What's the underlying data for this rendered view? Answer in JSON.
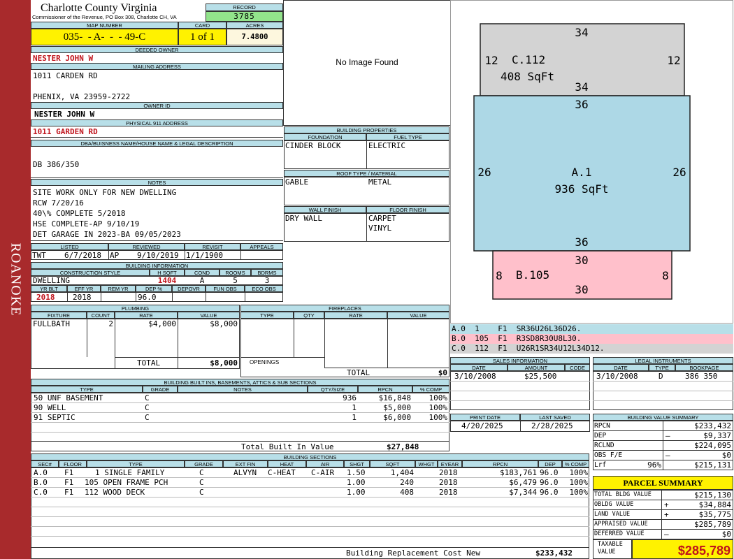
{
  "sidebar": {
    "label": "ROANOKE"
  },
  "header": {
    "county": "Charlotte County Virginia",
    "address": "Commissioner of the Revenue, PO Box 308, Charlotte CH, VA",
    "record_label": "RECORD",
    "record": "3785"
  },
  "map": {
    "map_label": "MAP NUMBER",
    "map_number": "035-  - A-  -  - 49-C",
    "card_label": "CARD",
    "card": "1 of 1",
    "acres_label": "ACRES",
    "acres": "7.4800"
  },
  "owner": {
    "deeded_label": "DEEDED OWNER",
    "deeded": "NESTER JOHN W",
    "mailing_label": "MAILING ADDRESS",
    "mail1": "1011 CARDEN RD",
    "mail2": "PHENIX, VA 23959-2722",
    "owner_id_label": "OWNER ID",
    "owner_id": "NESTER JOHN W",
    "physical_label": "PHYSICAL 911 ADDRESS",
    "physical": "1011 GARDEN RD"
  },
  "dba": {
    "label": "DBA/BUISNESS NAME/HOUSE NAME & LEGAL DESCRIPTION",
    "text": "DB 386/350"
  },
  "notes": {
    "label": "NOTES",
    "lines": [
      "SITE WORK ONLY FOR NEW DWELLING",
      "RCW 7/20/16",
      "40\\% COMPLETE 5/2018",
      "HSE COMPLETE-AP 9/10/19",
      "DET GARAGE IN 2023-BA 09/05/2023"
    ]
  },
  "listing": {
    "listed_label": "LISTED",
    "reviewed_label": "REVIEWED",
    "revisit_label": "REVISIT",
    "appeals_label": "APPEALS",
    "listed_by": "TWT",
    "listed_date": "6/7/2018",
    "reviewed_by": "AP",
    "reviewed_date": "9/10/2019",
    "revisit": "1/1/1900"
  },
  "building_info": {
    "label": "BUILDING INFORMATION",
    "h": [
      "CONSTRUCTION STYLE",
      "H SQFT",
      "COND",
      "ROOMS",
      "BDRMS"
    ],
    "style": "DWELLING",
    "hsqft": "1404",
    "cond": "A",
    "rooms": "5",
    "bdrms": "3",
    "h2": [
      "YR BLT",
      "EFF YR",
      "REM YR",
      "DEP %",
      "DEPOVR",
      "FUN OBS",
      "ECO OBS"
    ],
    "yrblt": "2018",
    "effyr": "2018",
    "dep": "96.0"
  },
  "image": {
    "text": "No Image Found"
  },
  "props": {
    "label": "BUILDING PROPERTIES",
    "foundation_label": "FOUNDATION",
    "fuel_label": "FUEL TYPE",
    "foundation": "CINDER BLOCK",
    "fuel": "ELECTRIC",
    "roof_label": "ROOF TYPE / MATERIAL",
    "roof_type": "GABLE",
    "roof_mat": "METAL",
    "wall_label": "WALL FINISH",
    "floor_label": "FLOOR FINISH",
    "wall": "DRY WALL",
    "floor1": "CARPET",
    "floor2": "VINYL"
  },
  "sketch": {
    "c_top": "34",
    "c_left": "12",
    "c_right": "12",
    "c_label": "C.112",
    "c_sqft": "408 SqFt",
    "c_bottom": "34",
    "a_top": "36",
    "a_left": "26",
    "a_right": "26",
    "a_label": "A.1",
    "a_sqft": "936 SqFt",
    "a_bottom": "36",
    "b_top": "30",
    "b_left": "8",
    "b_right": "8",
    "b_label": "B.105",
    "b_bottom": "30"
  },
  "sketch_codes": [
    {
      "text": "A.0  1    F1  SR36U26L36D26.",
      "color": "#b8dfe8"
    },
    {
      "text": "B.0  105  F1  R3SD8R30U8L30.",
      "color": "#ffc0cb"
    },
    {
      "text": "C.0  112  F1  U26R1SR34U12L34D12.",
      "color": "#d3d3d3"
    }
  ],
  "plumbing": {
    "label": "PLUMBING",
    "h": [
      "FIXTURE",
      "COUNT",
      "RATE",
      "VALUE"
    ],
    "fixture": "FULLBATH",
    "count": "2",
    "rate": "$4,000",
    "value": "$8,000",
    "total_label": "TOTAL",
    "total": "$8,000"
  },
  "fireplaces": {
    "label": "FIREPLACES",
    "h": [
      "TYPE",
      "QTY",
      "RATE",
      "VALUE"
    ],
    "openings": "OPENINGS",
    "total_label": "TOTAL",
    "total": "$0"
  },
  "sales": {
    "label": "SALES INFORMATION",
    "h": [
      "DATE",
      "AMOUNT",
      "CODE"
    ],
    "date": "3/10/2008",
    "amount": "$25,500"
  },
  "legal": {
    "label": "LEGAL INSTRUMENTS",
    "h": [
      "DATE",
      "TYPE",
      "BOOKPAGE"
    ],
    "date": "3/10/2008",
    "type": "D",
    "book": "386 350"
  },
  "builtins": {
    "label": "BUILDING BUILT INS, BASEMENTS, ATTICS & SUB SECTIONS",
    "h": [
      "TYPE",
      "GRADE",
      "NOTES",
      "QTY/SIZE",
      "RPCN",
      "% COMP"
    ],
    "rows": [
      {
        "type": "50 UNF BASEMENT",
        "grade": "C",
        "qty": "936",
        "rpcn": "$16,848",
        "comp": "100%"
      },
      {
        "type": "90 WELL",
        "grade": "C",
        "qty": "1",
        "rpcn": "$5,000",
        "comp": "100%"
      },
      {
        "type": "91 SEPTIC",
        "grade": "C",
        "qty": "1",
        "rpcn": "$6,000",
        "comp": "100%"
      }
    ],
    "total_label": "Total Built In Value",
    "total": "$27,848"
  },
  "print": {
    "print_label": "PRINT DATE",
    "saved_label": "LAST SAVED",
    "print_date": "4/20/2025",
    "saved": "2/28/2025"
  },
  "value_summary": {
    "label": "BUILDING VALUE SUMMARY",
    "rows": [
      {
        "label": "RPCN",
        "sign": "",
        "pct": "",
        "value": "$233,432"
      },
      {
        "label": "DEP",
        "sign": "–",
        "pct": "",
        "value": "$9,337"
      },
      {
        "label": "RCLND",
        "sign": "",
        "pct": "",
        "value": "$224,095"
      },
      {
        "label": "OBS F/E",
        "sign": "–",
        "pct": "",
        "value": "$0"
      },
      {
        "label": "Lrf",
        "sign": "",
        "pct": "96%",
        "value": "$215,131"
      }
    ]
  },
  "sections": {
    "label": "BUILDING SECTIONS",
    "h": [
      "SEC#",
      "FLOOR",
      "TYPE",
      "GRADE",
      "EXT FIN",
      "HEAT",
      "AIR",
      "SHGT",
      "SQFT",
      "WHGT",
      "EYEAR",
      "RPCN",
      "DEP",
      "% COMP"
    ],
    "rows": [
      {
        "sec": "A.0",
        "floor": "F1",
        "type": "1 SINGLE FAMILY",
        "grade": "C",
        "ext": "ALVYN",
        "heat": "C-HEAT",
        "air": "C-AIR",
        "shgt": "1.50",
        "sqft": "1,404",
        "eyear": "2018",
        "rpcn": "$183,761",
        "dep": "96.0",
        "comp": "100%"
      },
      {
        "sec": "B.0",
        "floor": "F1",
        "type": "105 OPEN FRAME PCH",
        "grade": "C",
        "ext": "",
        "heat": "",
        "air": "",
        "shgt": "1.00",
        "sqft": "240",
        "eyear": "2018",
        "rpcn": "$6,479",
        "dep": "96.0",
        "comp": "100%"
      },
      {
        "sec": "C.0",
        "floor": "F1",
        "type": "112 WOOD DECK",
        "grade": "C",
        "ext": "",
        "heat": "",
        "air": "",
        "shgt": "1.00",
        "sqft": "408",
        "eyear": "2018",
        "rpcn": "$7,344",
        "dep": "96.0",
        "comp": "100%"
      }
    ],
    "total_label": "Building Replacement Cost New",
    "total": "$233,432"
  },
  "parcel": {
    "label": "PARCEL SUMMARY",
    "rows": [
      {
        "label": "TOTAL BLDG VALUE",
        "sign": "",
        "value": "$215,130"
      },
      {
        "label": "OBLDG VALUE",
        "sign": "+",
        "value": "$34,884"
      },
      {
        "label": "LAND VALUE",
        "sign": "+",
        "value": "$35,775"
      },
      {
        "label": "APPRAISED VALUE",
        "sign": "",
        "value": "$285,789"
      },
      {
        "label": "DEFERRED VALUE",
        "sign": "–",
        "value": "$0"
      }
    ],
    "taxable_label1": "TAXABLE",
    "taxable_label2": "VALUE",
    "taxable": "$285,789"
  }
}
